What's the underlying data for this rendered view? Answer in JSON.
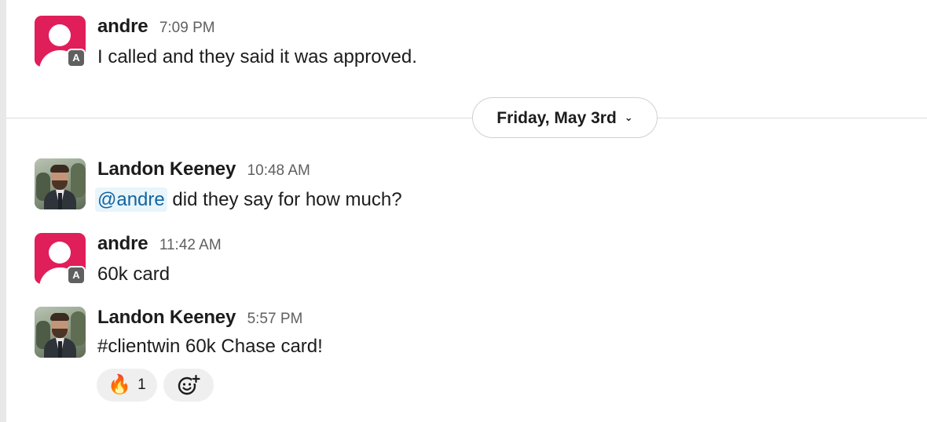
{
  "messages": [
    {
      "author": "andre",
      "time": "7:09 PM",
      "text": "I called and they said it was approved.",
      "badge": "A"
    },
    {
      "author": "Landon Keeney",
      "time": "10:48 AM",
      "mention": "@andre",
      "text": " did they say for how much?"
    },
    {
      "author": "andre",
      "time": "11:42 AM",
      "text": "60k card",
      "badge": "A"
    },
    {
      "author": "Landon Keeney",
      "time": "5:57 PM",
      "text": "#clientwin 60k Chase card!"
    }
  ],
  "date_divider": {
    "label": "Friday, May 3rd",
    "icon": "chevron-down-icon"
  },
  "reactions": [
    {
      "emoji": "🔥",
      "count": "1",
      "icon": "fire-emoji"
    },
    {
      "icon": "add-reaction-icon"
    }
  ],
  "colors": {
    "accent_avatar": "#e01e5a",
    "mention_text": "#1264a3",
    "mention_bg": "#e8f5fa",
    "reaction_bg": "#efefef",
    "timestamp": "#616061"
  }
}
